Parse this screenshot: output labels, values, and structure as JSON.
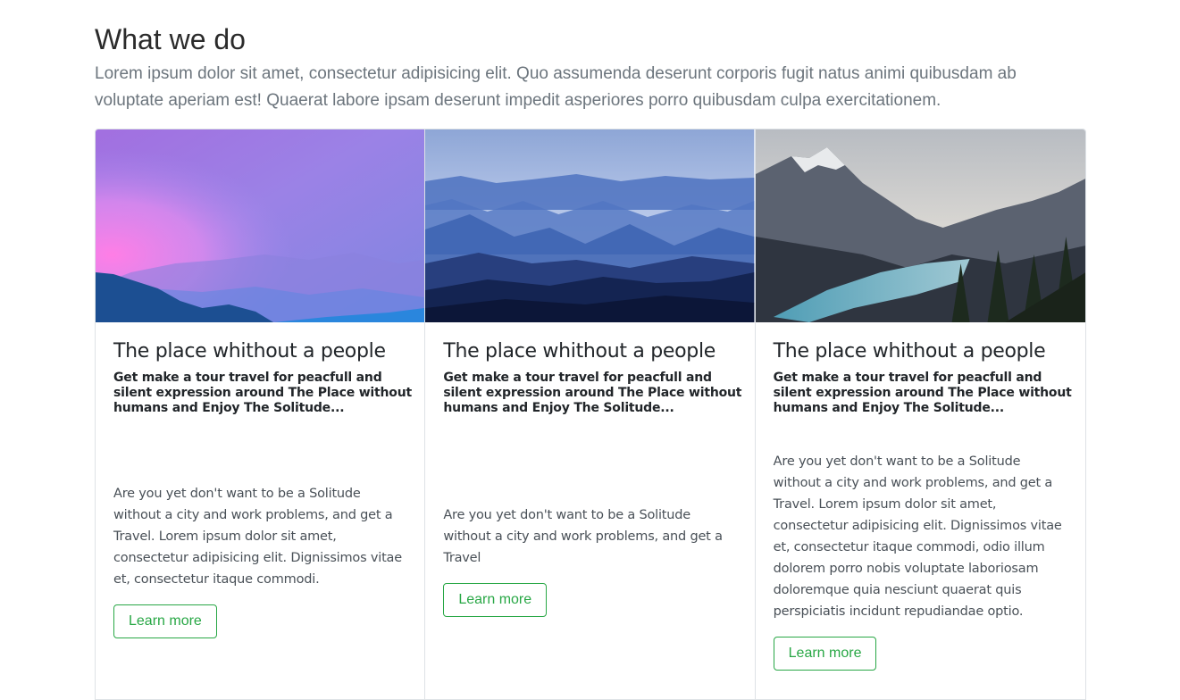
{
  "section": {
    "title": "What we do",
    "lead": "Lorem ipsum dolor sit amet, consectetur adipisicing elit. Quo assumenda deserunt corporis fugit natus animi quibusdam ab voluptate aperiam est! Quaerat labore ipsam deserunt impedit asperiores porro quibusdam culpa exercitationem."
  },
  "cards": [
    {
      "image": "pink-purple-mountain-sunset",
      "title": "The place whithout a people",
      "subtitle": "Get make a tour travel for peacfull and silent expression around The Place without humans and Enjoy The Solitude...",
      "text": "Are you yet don't want to be a Solitude without a city and work problems, and get a Travel. Lorem ipsum dolor sit amet, consectetur adipisicing elit. Dignissimos vitae et, consectetur itaque commodi.",
      "button": "Learn more"
    },
    {
      "image": "blue-misty-mountain-layers",
      "title": "The place whithout a people",
      "subtitle": "Get make a tour travel for peacfull and silent expression around The Place without humans and Enjoy The Solitude...",
      "text": "Are you yet don't want to be a Solitude without a city and work problems, and get a Travel",
      "button": "Learn more"
    },
    {
      "image": "mountain-lake-forest",
      "title": "The place whithout a people",
      "subtitle": "Get make a tour travel for peacfull and silent expression around The Place without humans and Enjoy The Solitude...",
      "text": "Are you yet don't want to be a Solitude without a city and work problems, and get a Travel. Lorem ipsum dolor sit amet, consectetur adipisicing elit. Dignissimos vitae et, consectetur itaque commodi, odio illum dolorem porro nobis voluptate laboriosam doloremque quia nesciunt quaerat quis perspiciatis incidunt repudiandae optio.",
      "button": "Learn more"
    }
  ],
  "colors": {
    "accent": "#28a745",
    "border": "#dee2e6",
    "muted_text": "#6c757d"
  }
}
